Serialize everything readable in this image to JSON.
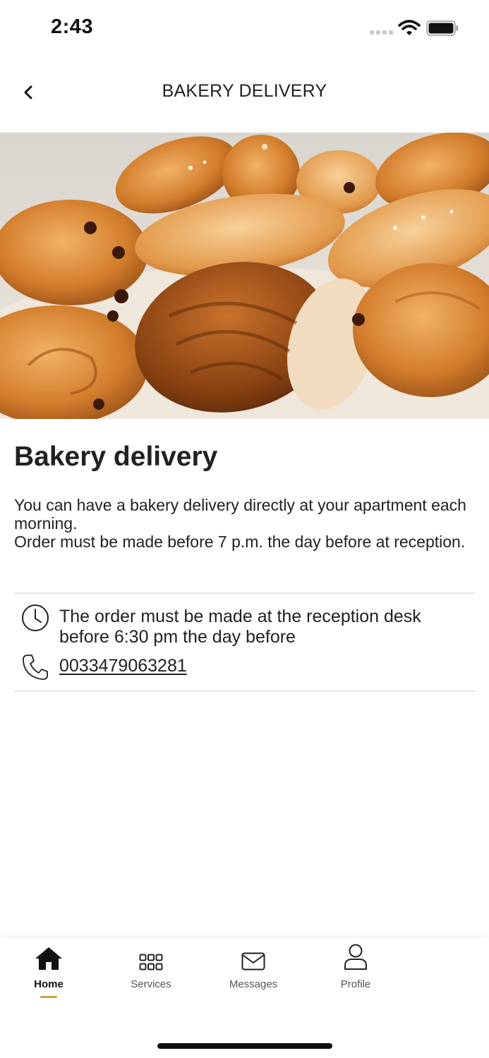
{
  "status_bar": {
    "time": "2:43"
  },
  "header": {
    "title": "BAKERY DELIVERY"
  },
  "icons": {
    "back": "chevron-left-icon",
    "clock": "clock-icon",
    "phone": "phone-icon",
    "home": "home-icon",
    "services": "grid-icon",
    "messages": "envelope-icon",
    "profile": "user-icon"
  },
  "content": {
    "title": "Bakery delivery",
    "description_lines": [
      "You can have a bakery delivery directly at your apartment each morning.",
      "Order must be made before 7 p.m. the day before at reception."
    ],
    "order_info": "The order must be made at the reception desk before 6:30 pm the day before",
    "phone": "0033479063281"
  },
  "tabs": [
    {
      "label": "Home",
      "active": true
    },
    {
      "label": "Services",
      "active": false
    },
    {
      "label": "Messages",
      "active": false
    },
    {
      "label": "Profile",
      "active": false
    }
  ],
  "colors": {
    "accent": "#c9a23f",
    "text": "#222222",
    "divider": "#e4e4e4"
  }
}
